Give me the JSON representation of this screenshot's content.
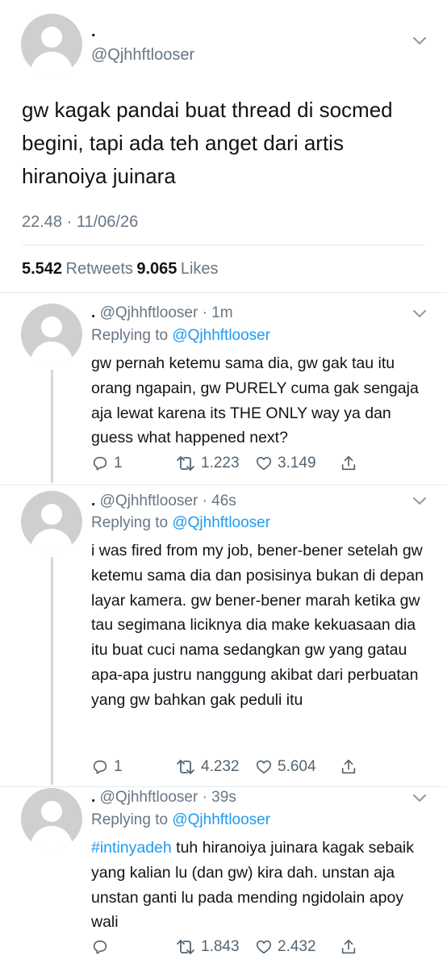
{
  "main_tweet": {
    "display_name": ".",
    "handle": "@Qjhhftlooser",
    "text": "gw kagak pandai buat thread di socmed begini, tapi ada teh anget dari artis hiranoiya juinara",
    "timestamp": "22.48 · 11/06/26",
    "retweets_count": "5.542",
    "retweets_label": "Retweets",
    "likes_count": "9.065",
    "likes_label": "Likes"
  },
  "replies": [
    {
      "display_name": ".",
      "handle_time": "@Qjhhftlooser · 1m",
      "replying_prefix": "Replying to",
      "replying_to": "@Qjhhftlooser",
      "text": "gw pernah ketemu sama dia, gw gak tau itu orang ngapain, gw PURELY cuma gak sengaja aja lewat karena its THE ONLY way ya dan guess what happened next?",
      "replies": "1",
      "retweets": "1.223",
      "likes": "3.149"
    },
    {
      "display_name": ".",
      "handle_time": "@Qjhhftlooser · 46s",
      "replying_prefix": "Replying to",
      "replying_to": "@Qjhhftlooser",
      "text": "i was fired from my job, bener-bener setelah gw ketemu sama dia dan posisinya bukan di depan layar kamera. gw bener-bener marah ketika gw tau segimana liciknya dia make kekuasaan dia itu buat cuci nama sedangkan gw yang gatau apa-apa justru nanggung akibat dari perbuatan yang gw bahkan gak peduli itu",
      "replies": "1",
      "retweets": "4.232",
      "likes": "5.604"
    },
    {
      "display_name": ".",
      "handle_time": "@Qjhhftlooser · 39s",
      "replying_prefix": "Replying to",
      "replying_to": "@Qjhhftlooser",
      "hashtag": "#intinyadeh",
      "text": " tuh hiranoiya juinara kagak sebaik yang kalian lu (dan gw) kira dah. unstan aja unstan ganti lu pada mending ngidolain apoy wali",
      "replies": "",
      "retweets": "1.843",
      "likes": "2.432"
    }
  ],
  "icons": {
    "avatar": "default-avatar-icon",
    "chevron": "chevron-down-icon",
    "reply": "reply-icon",
    "retweet": "retweet-icon",
    "like": "like-icon",
    "share": "share-icon"
  },
  "colors": {
    "link": "#1d9bf0",
    "secondary_text": "#687684",
    "avatar_bg": "#cfcfcf"
  }
}
